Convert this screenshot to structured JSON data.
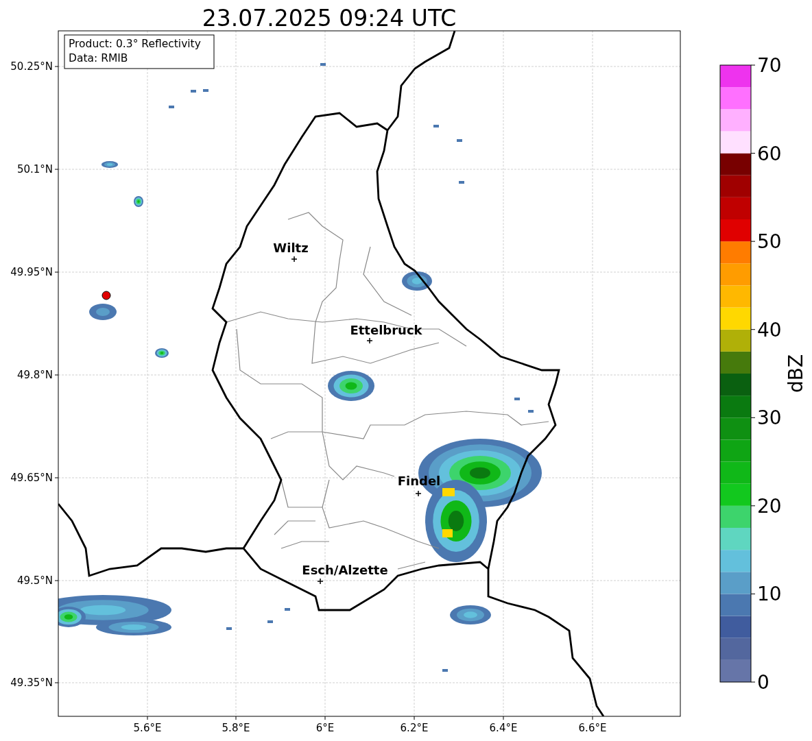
{
  "title": "23.07.2025 09:24 UTC",
  "legend": [
    "Product: 0.3° Reflectivity",
    "Data: RMIB"
  ],
  "cities": [
    {
      "name": "Wiltz"
    },
    {
      "name": "Ettelbruck"
    },
    {
      "name": "Findel"
    },
    {
      "name": "Esch/Alzette"
    }
  ],
  "x_ticks": [
    "5.6°E",
    "5.8°E",
    "6°E",
    "6.2°E",
    "6.4°E",
    "6.6°E"
  ],
  "y_ticks": [
    "50.25°N",
    "50.1°N",
    "49.95°N",
    "49.8°N",
    "49.65°N",
    "49.5°N",
    "49.35°N"
  ],
  "colorbar": {
    "label": "dBZ",
    "ticks": [
      "70",
      "60",
      "50",
      "40",
      "30",
      "20",
      "10",
      "0"
    ],
    "segments": [
      {
        "color": "#6675a8"
      },
      {
        "color": "#53679e"
      },
      {
        "color": "#405c9e"
      },
      {
        "color": "#4b78b0"
      },
      {
        "color": "#5a9ec8"
      },
      {
        "color": "#63c0dc"
      },
      {
        "color": "#5fd6c0"
      },
      {
        "color": "#3dd46c"
      },
      {
        "color": "#12c81e"
      },
      {
        "color": "#10b818"
      },
      {
        "color": "#0fa514"
      },
      {
        "color": "#0f9012"
      },
      {
        "color": "#0a7a10"
      },
      {
        "color": "#0a6010"
      },
      {
        "color": "#467a0c"
      },
      {
        "color": "#b0b008"
      },
      {
        "color": "#ffd800"
      },
      {
        "color": "#ffb800"
      },
      {
        "color": "#ff9c00"
      },
      {
        "color": "#ff7c00"
      },
      {
        "color": "#e00000"
      },
      {
        "color": "#c00000"
      },
      {
        "color": "#a00000"
      },
      {
        "color": "#780000"
      },
      {
        "color": "#ffe0ff"
      },
      {
        "color": "#ffb0ff"
      },
      {
        "color": "#ff70ff"
      },
      {
        "color": "#ee33ee"
      }
    ]
  }
}
